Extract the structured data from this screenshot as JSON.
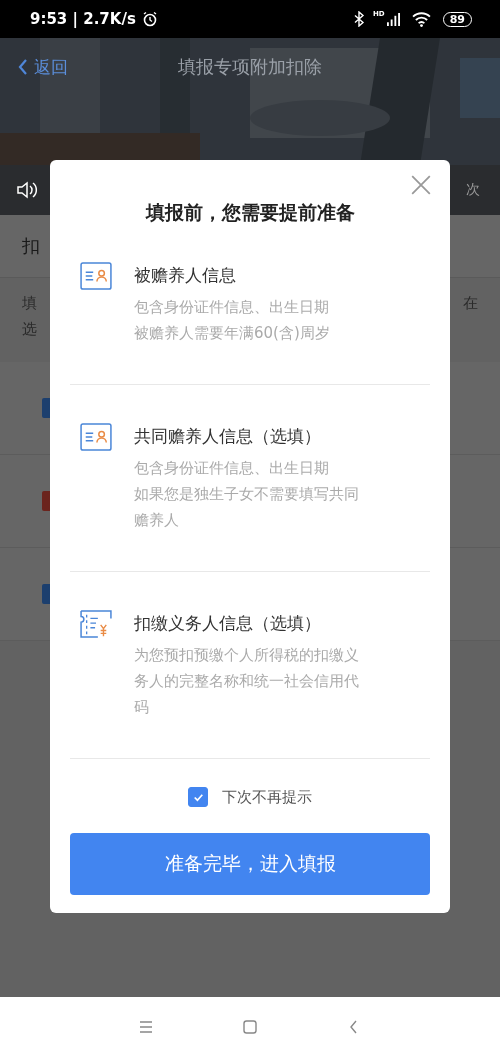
{
  "status_bar": {
    "time": "9:53 | 2.7K/s",
    "signal_label": "HD",
    "battery": "89"
  },
  "header": {
    "back": "返回",
    "title": "填报专项附加扣除"
  },
  "notice": {
    "tail": "次"
  },
  "background": {
    "section_title": "扣",
    "text_left": [
      "填",
      "选"
    ],
    "text_right": "在",
    "rows": [
      {
        "color": "#1c3f6e"
      },
      {
        "color": "#6b241d"
      },
      {
        "color": "#1c3f6e"
      }
    ]
  },
  "dialog": {
    "title": "填报前，您需要提前准备",
    "items": [
      {
        "kind": "id-card",
        "title": "被赡养人信息",
        "lines": [
          "包含身份证件信息、出生日期",
          "被赡养人需要年满60(含)周岁"
        ]
      },
      {
        "kind": "id-card",
        "title": "共同赡养人信息（选填）",
        "lines": [
          "包含身份证件信息、出生日期",
          "如果您是独生子女不需要填写共同赡养人"
        ]
      },
      {
        "kind": "receipt",
        "title": "扣缴义务人信息（选填）",
        "lines": [
          "为您预扣预缴个人所得税的扣缴义务人的完整名称和统一社会信用代码"
        ]
      }
    ],
    "dont_remind": {
      "label": "下次不再提示",
      "checked": true
    },
    "confirm": "准备完毕，进入填报"
  }
}
